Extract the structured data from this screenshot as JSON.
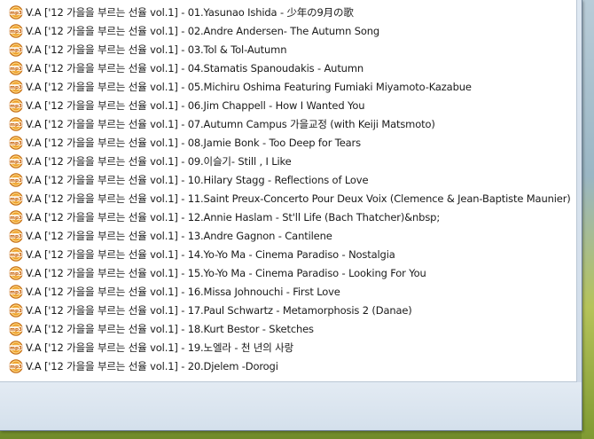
{
  "files": [
    {
      "name": "V.A ['12 가을을 부르는 선율 vol.1] - 01.Yasunao Ishida - 少年の9月の歌",
      "icon": "mp3-file-icon"
    },
    {
      "name": "V.A ['12 가을을 부르는 선율 vol.1] - 02.Andre Andersen- The Autumn Song",
      "icon": "mp3-file-icon"
    },
    {
      "name": "V.A ['12 가을을 부르는 선율 vol.1] - 03.Tol & Tol-Autumn",
      "icon": "mp3-file-icon"
    },
    {
      "name": "V.A ['12 가을을 부르는 선율 vol.1] - 04.Stamatis Spanoudakis - Autumn",
      "icon": "mp3-file-icon"
    },
    {
      "name": "V.A ['12 가을을 부르는 선율 vol.1] - 05.Michiru Oshima Featuring Fumiaki Miyamoto-Kazabue",
      "icon": "mp3-file-icon"
    },
    {
      "name": "V.A ['12 가을을 부르는 선율 vol.1] - 06.Jim Chappell - How I Wanted You",
      "icon": "mp3-file-icon"
    },
    {
      "name": "V.A ['12 가을을 부르는 선율 vol.1] - 07.Autumn Campus 가을교정 (with Keiji Matsmoto)",
      "icon": "mp3-file-icon"
    },
    {
      "name": "V.A ['12 가을을 부르는 선율 vol.1] - 08.Jamie Bonk - Too Deep for Tears",
      "icon": "mp3-file-icon"
    },
    {
      "name": "V.A ['12 가을을 부르는 선율 vol.1] - 09.이슬기- Still , I Like",
      "icon": "mp3-file-icon"
    },
    {
      "name": "V.A ['12 가을을 부르는 선율 vol.1] - 10.Hilary Stagg - Reflections of Love",
      "icon": "mp3-file-icon"
    },
    {
      "name": "V.A ['12 가을을 부르는 선율 vol.1] - 11.Saint Preux-Concerto Pour Deux Voix (Clemence & Jean-Baptiste Maunier)",
      "icon": "mp3-file-icon"
    },
    {
      "name": "V.A ['12 가을을 부르는 선율 vol.1] - 12.Annie Haslam - St'll Life (Bach  Thatcher)&nbsp;",
      "icon": "mp3-file-icon"
    },
    {
      "name": "V.A ['12 가을을 부르는 선율 vol.1] - 13.Andre Gagnon - Cantilene",
      "icon": "mp3-file-icon"
    },
    {
      "name": "V.A ['12 가을을 부르는 선율 vol.1] - 14.Yo-Yo Ma - Cinema Paradiso - Nostalgia",
      "icon": "mp3-file-icon"
    },
    {
      "name": "V.A ['12 가을을 부르는 선율 vol.1] - 15.Yo-Yo Ma  - Cinema Paradiso - Looking For You",
      "icon": "mp3-file-icon"
    },
    {
      "name": "V.A ['12 가을을 부르는 선율 vol.1] - 16.Missa Johnouchi - First Love",
      "icon": "mp3-file-icon"
    },
    {
      "name": "V.A ['12 가을을 부르는 선율 vol.1] - 17.Paul Schwartz - Metamorphosis  2 (Danae)",
      "icon": "mp3-file-icon"
    },
    {
      "name": "V.A ['12 가을을 부르는 선율 vol.1] - 18.Kurt Bestor - Sketches",
      "icon": "mp3-file-icon"
    },
    {
      "name": "V.A ['12 가을을 부르는 선율 vol.1] - 19.노엘라 - 천 년의 사랑",
      "icon": "mp3-file-icon"
    },
    {
      "name": "V.A ['12 가을을 부르는 선율 vol.1] - 20.Djelem -Dorogi",
      "icon": "mp3-file-icon"
    }
  ],
  "icon_label": "mp3",
  "colors": {
    "icon_orange": "#e8931c",
    "icon_ring": "#c46a10",
    "text": "#1a1a1a",
    "list_background": "#ffffff",
    "window_frame": "#d4e0ec"
  }
}
